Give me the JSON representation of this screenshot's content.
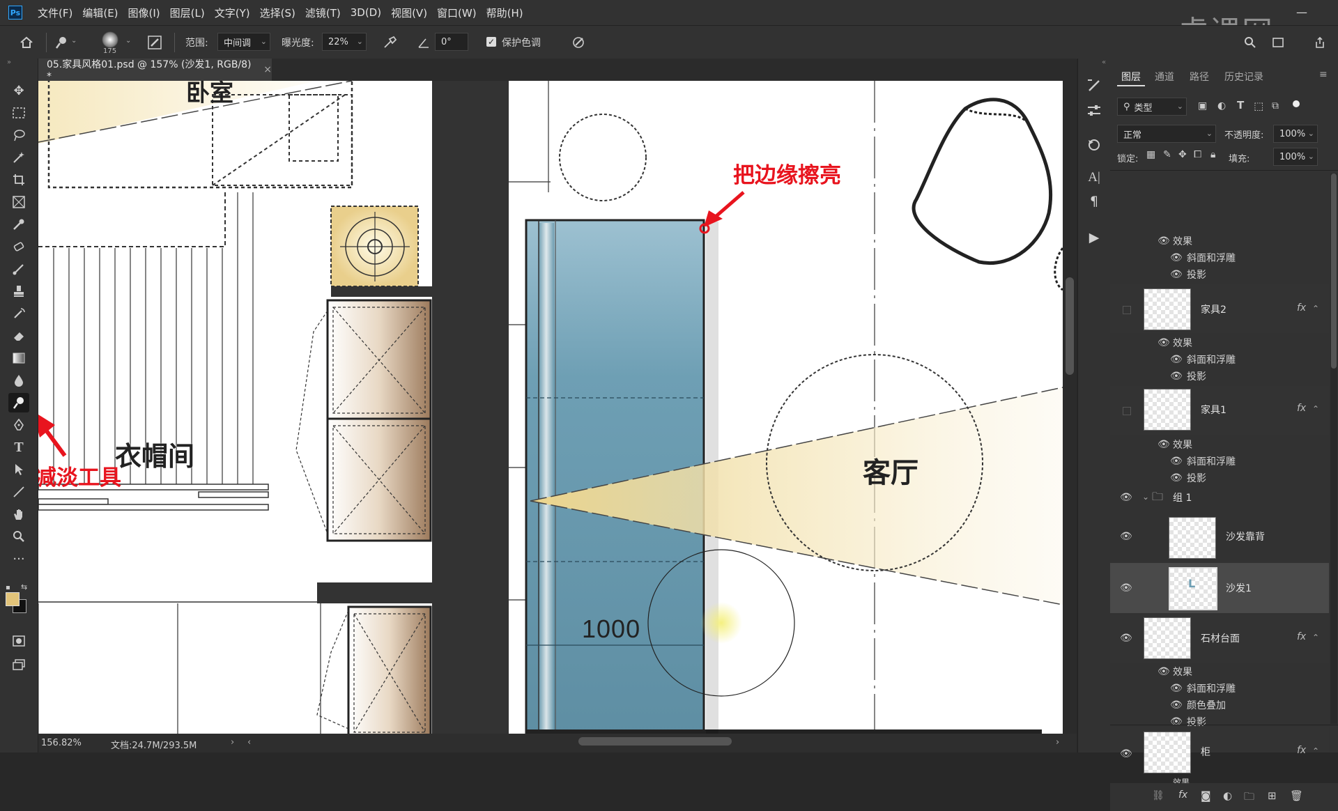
{
  "menu": {
    "logo": "Ps",
    "items": [
      "文件(F)",
      "编辑(E)",
      "图像(I)",
      "图层(L)",
      "文字(Y)",
      "选择(S)",
      "滤镜(T)",
      "3D(D)",
      "视图(V)",
      "窗口(W)",
      "帮助(H)"
    ]
  },
  "options": {
    "brush_size": "175",
    "range_label": "范围:",
    "range_value": "中间调",
    "exposure_label": "曝光度:",
    "exposure_value": "22%",
    "angle_value": "0°",
    "protect_tones_label": "保护色调",
    "protect_tones_checked": true
  },
  "document": {
    "tab_title": "05.家具风格01.psd @ 157% (沙发1, RGB/8) *",
    "zoom": "156.82%",
    "doc_info": "文档:24.7M/293.5M"
  },
  "canvas": {
    "room_top_left": "卧室",
    "room_closet": "衣帽间",
    "room_living": "客厅",
    "dimension": "1000",
    "annotation_dodge": "把边缘擦亮",
    "annotation_tool": "减淡工具",
    "sofa_color": "#6e9fb4"
  },
  "watermark": "虎课网",
  "layers_panel": {
    "tabs": [
      "图层",
      "通道",
      "路径",
      "历史记录"
    ],
    "filter_label": "类型",
    "blend_mode": "正常",
    "opacity_label": "不透明度:",
    "opacity_value": "100%",
    "lock_label": "锁定:",
    "fill_label": "填充:",
    "fill_value": "100%",
    "effects_label": "效果",
    "top_effects": [
      "斜面和浮雕",
      "投影"
    ],
    "layers": [
      {
        "name": "家具2",
        "fx": "fx",
        "effects": [
          "斜面和浮雕",
          "投影"
        ]
      },
      {
        "name": "家具1",
        "fx": "fx",
        "effects": [
          "斜面和浮雕",
          "投影"
        ]
      },
      {
        "name": "组 1",
        "type": "group"
      },
      {
        "name": "沙发靠背"
      },
      {
        "name": "沙发1",
        "selected": true
      },
      {
        "name": "石材台面",
        "fx": "fx",
        "effects": [
          "斜面和浮雕",
          "颜色叠加",
          "投影"
        ]
      },
      {
        "name": "柜",
        "fx": "fx",
        "effects": [
          "效果"
        ]
      }
    ]
  }
}
